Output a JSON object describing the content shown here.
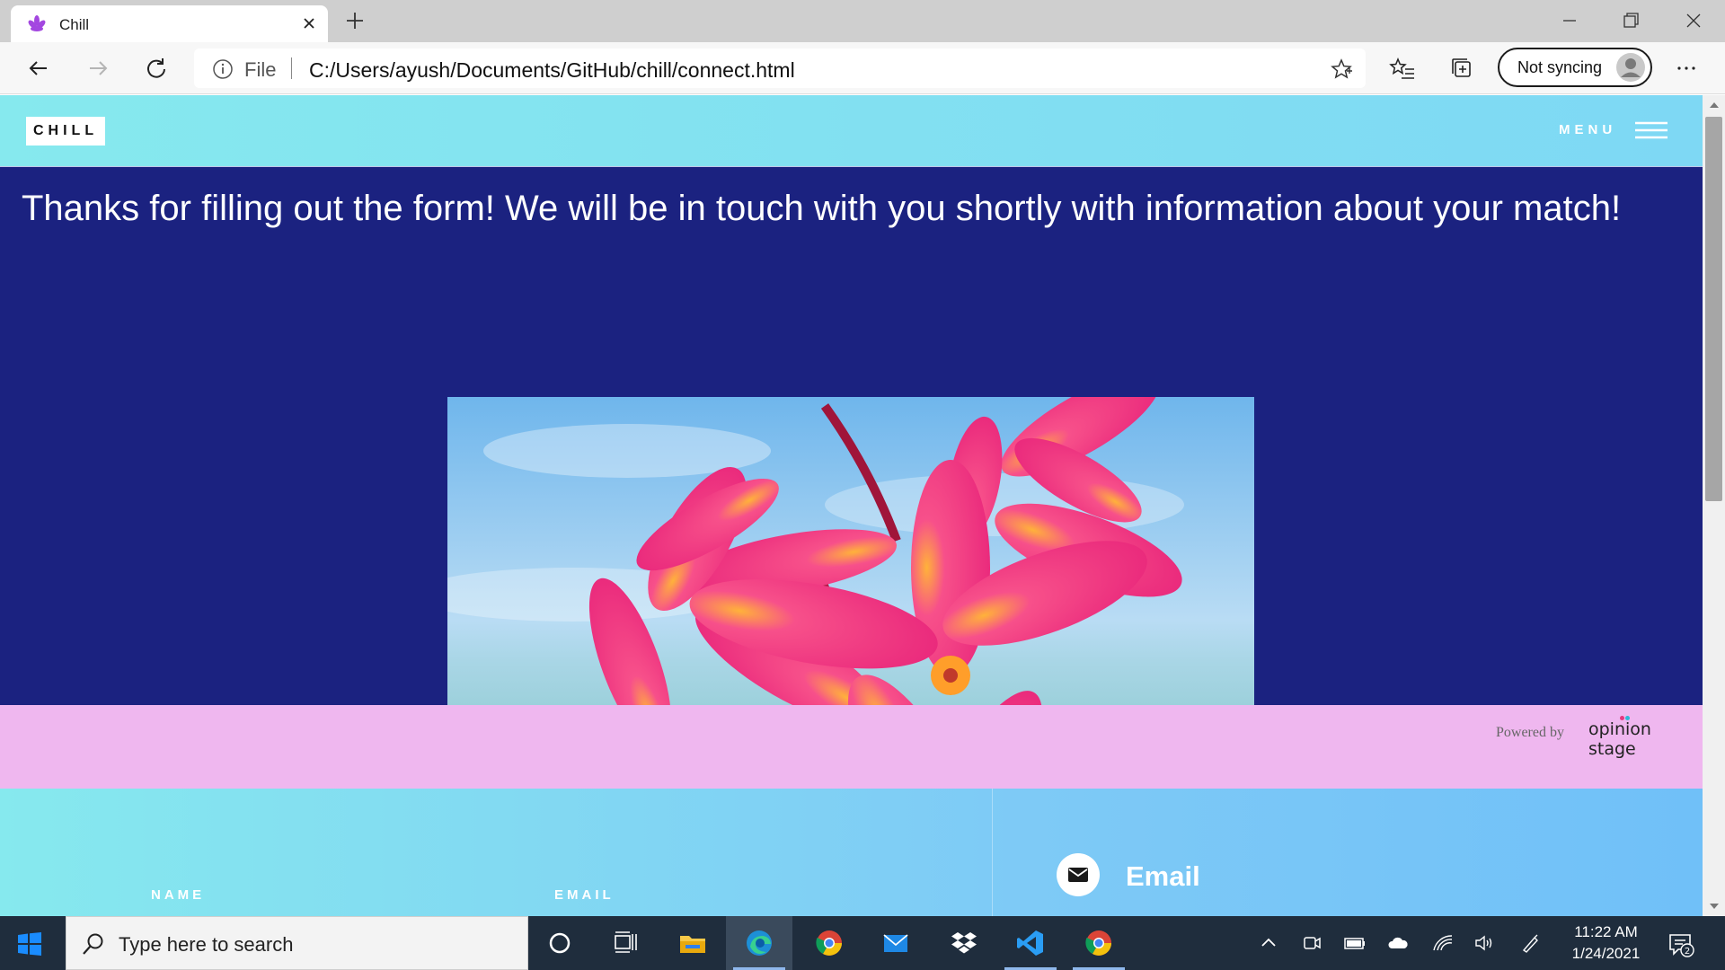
{
  "browser": {
    "tab_title": "Chill",
    "address_prefix": "File",
    "url": "C:/Users/ayush/Documents/GitHub/chill/connect.html",
    "sync_label": "Not syncing"
  },
  "site": {
    "logo": "CHILL",
    "menu_label": "MENU",
    "thanks_message": "Thanks for filling out the form! We will be in touch with you shortly with information about your match!",
    "powered_by": "Powered by",
    "powered_brand": "opinion stage",
    "contact": {
      "name_label": "NAME",
      "email_label": "EMAIL",
      "email_title": "Email"
    }
  },
  "taskbar": {
    "search_placeholder": "Type here to search",
    "time": "11:22 AM",
    "date": "1/24/2021",
    "notification_count": "2"
  },
  "colors": {
    "header_cyan": "#86e9ee",
    "navy": "#1b2280",
    "pink_band": "#efb7ef",
    "taskbar": "#1f2d3d"
  }
}
